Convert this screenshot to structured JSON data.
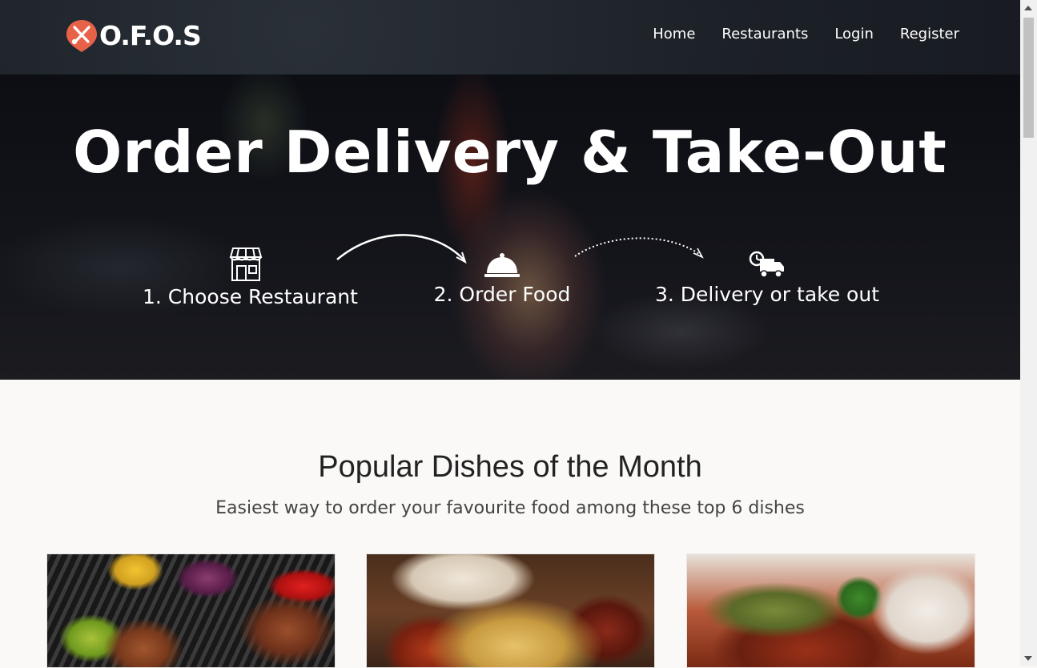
{
  "brand": {
    "name": "O.F.O.S",
    "accent": "#e8624a"
  },
  "nav": {
    "items": [
      "Home",
      "Restaurants",
      "Login",
      "Register"
    ]
  },
  "hero": {
    "title": "Order Delivery & Take-Out",
    "steps": [
      {
        "label": "1. Choose Restaurant",
        "icon": "store-icon"
      },
      {
        "label": "2. Order Food",
        "icon": "food-cloche-icon"
      },
      {
        "label": "3. Delivery or take out",
        "icon": "delivery-truck-icon"
      }
    ]
  },
  "popular": {
    "title": "Popular Dishes of the Month",
    "subtitle": "Easiest way to order your favourite food among these top 6 dishes"
  }
}
